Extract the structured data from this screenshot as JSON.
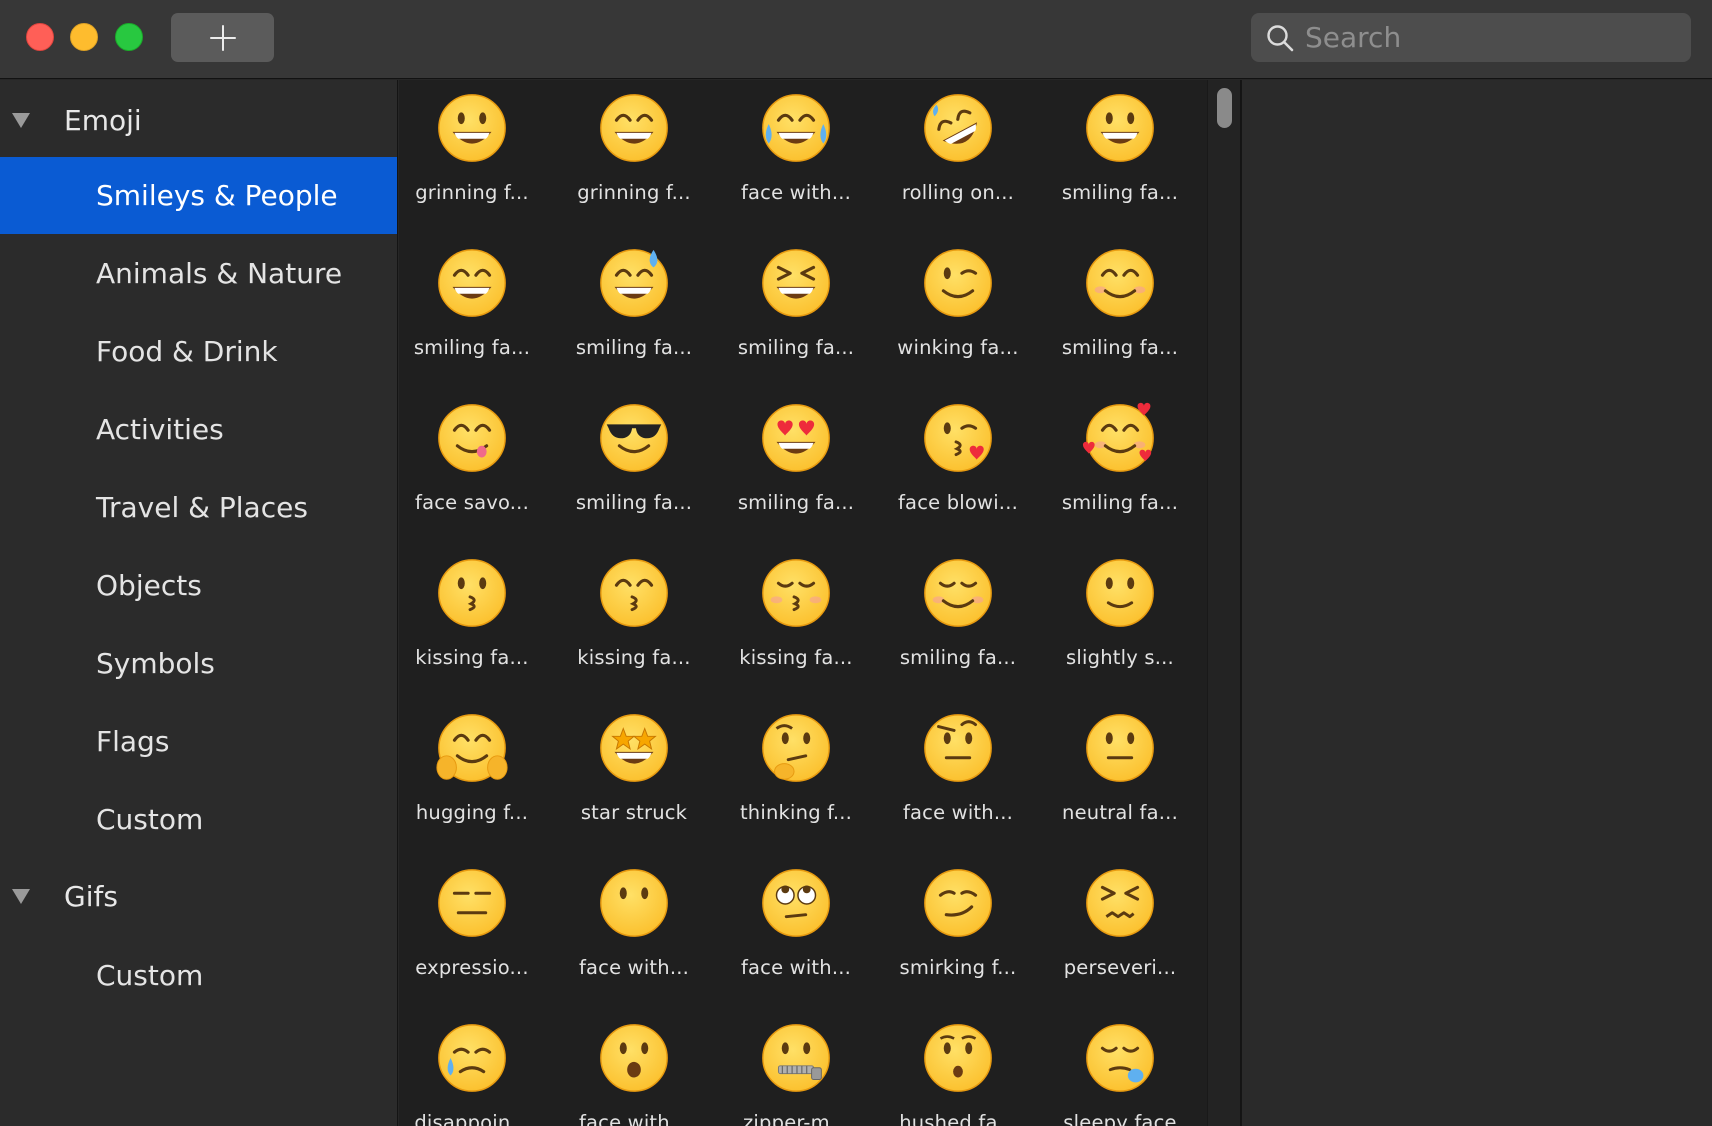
{
  "titlebar": {
    "search": {
      "placeholder": "Search"
    }
  },
  "sidebar": {
    "groups": [
      {
        "label": "Emoji",
        "items": [
          {
            "label": "Smileys & People",
            "selected": true
          },
          {
            "label": "Animals & Nature"
          },
          {
            "label": "Food & Drink"
          },
          {
            "label": "Activities"
          },
          {
            "label": "Travel & Places"
          },
          {
            "label": "Objects"
          },
          {
            "label": "Symbols"
          },
          {
            "label": "Flags"
          },
          {
            "label": "Custom"
          }
        ]
      },
      {
        "label": "Gifs",
        "items": [
          {
            "label": "Custom"
          }
        ]
      }
    ]
  },
  "colors": {
    "selection": "#0a5bd3",
    "emoji_yellow": "#fbc02d",
    "emoji_outline": "#e79a10",
    "emoji_feature": "#5b3a10"
  },
  "grid": {
    "cells": [
      {
        "name": "grinning f...",
        "icon": "grinning-face-icon"
      },
      {
        "name": "grinning f...",
        "icon": "grinning-face-with-smiling-eyes-icon"
      },
      {
        "name": "face with...",
        "icon": "face-with-tears-of-joy-icon"
      },
      {
        "name": "rolling on...",
        "icon": "rolling-on-the-floor-laughing-icon"
      },
      {
        "name": "smiling fa...",
        "icon": "smiling-face-with-open-mouth-icon"
      },
      {
        "name": "smiling fa...",
        "icon": "smiling-face-open-mouth-smiling-eyes-icon"
      },
      {
        "name": "smiling fa...",
        "icon": "smiling-face-with-sweat-icon"
      },
      {
        "name": "smiling fa...",
        "icon": "smiling-face-closed-eyes-icon"
      },
      {
        "name": "winking fa...",
        "icon": "winking-face-icon"
      },
      {
        "name": "smiling fa...",
        "icon": "smiling-face-with-smiling-eyes-icon"
      },
      {
        "name": "face savo...",
        "icon": "face-savoring-food-icon"
      },
      {
        "name": "smiling fa...",
        "icon": "smiling-face-with-sunglasses-icon"
      },
      {
        "name": "smiling fa...",
        "icon": "smiling-face-with-heart-eyes-icon"
      },
      {
        "name": "face blowi...",
        "icon": "face-blowing-a-kiss-icon"
      },
      {
        "name": "smiling fa...",
        "icon": "smiling-face-with-hearts-icon"
      },
      {
        "name": "kissing fa...",
        "icon": "kissing-face-icon"
      },
      {
        "name": "kissing fa...",
        "icon": "kissing-face-with-smiling-eyes-icon"
      },
      {
        "name": "kissing fa...",
        "icon": "kissing-face-with-closed-eyes-icon"
      },
      {
        "name": "smiling fa...",
        "icon": "smiling-face-icon"
      },
      {
        "name": "slightly s...",
        "icon": "slightly-smiling-face-icon"
      },
      {
        "name": "hugging f...",
        "icon": "hugging-face-icon"
      },
      {
        "name": "star struck",
        "icon": "star-struck-icon"
      },
      {
        "name": "thinking f...",
        "icon": "thinking-face-icon"
      },
      {
        "name": "face with...",
        "icon": "face-with-raised-eyebrow-icon"
      },
      {
        "name": "neutral fa...",
        "icon": "neutral-face-icon"
      },
      {
        "name": "expressio...",
        "icon": "expressionless-face-icon"
      },
      {
        "name": "face with...",
        "icon": "face-without-mouth-icon"
      },
      {
        "name": "face with...",
        "icon": "face-with-rolling-eyes-icon"
      },
      {
        "name": "smirking f...",
        "icon": "smirking-face-icon"
      },
      {
        "name": "perseveri...",
        "icon": "persevering-face-icon"
      },
      {
        "name": "disappoin...",
        "icon": "disappointed-but-relieved-face-icon"
      },
      {
        "name": "face with...",
        "icon": "face-with-open-mouth-icon"
      },
      {
        "name": "zipper-m...",
        "icon": "zipper-mouth-face-icon"
      },
      {
        "name": "hushed fa...",
        "icon": "hushed-face-icon"
      },
      {
        "name": "sleepy face",
        "icon": "sleepy-face-icon"
      }
    ]
  }
}
